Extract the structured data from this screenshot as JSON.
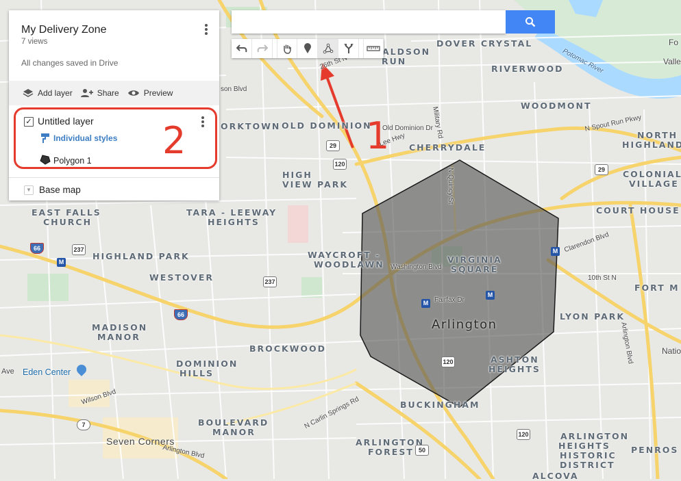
{
  "panel": {
    "title": "My Delivery Zone",
    "views": "7 views",
    "save_status": "All changes saved in Drive",
    "actions": {
      "add_layer": "Add layer",
      "share": "Share",
      "preview": "Preview"
    },
    "layer": {
      "title": "Untitled layer",
      "checked": true,
      "styles_link": "Individual styles",
      "feature": "Polygon 1"
    },
    "base_map": "Base map"
  },
  "search": {
    "placeholder": ""
  },
  "toolbar": {
    "tools": [
      "undo-icon",
      "redo-icon",
      "hand-icon",
      "marker-icon",
      "draw-line-icon",
      "route-icon",
      "ruler-icon"
    ],
    "active": "draw-line-icon"
  },
  "annotations": {
    "step1": "1",
    "step2": "2"
  },
  "map": {
    "place_labels": [
      {
        "text": "DOVER CRYSTAL"
      },
      {
        "text": "RIVERWOOD"
      },
      {
        "text": "WOODMONT"
      },
      {
        "text": "NORTH"
      },
      {
        "text": "HIGHLAND"
      },
      {
        "text": "COLONIAL"
      },
      {
        "text": "VILLAGE"
      },
      {
        "text": "COURT HOUSE"
      },
      {
        "text": "CHERRYDALE"
      },
      {
        "text": "ALDSON"
      },
      {
        "text": "RUN"
      },
      {
        "text": "ORKTOWN"
      },
      {
        "text": "OLD DOMINION"
      },
      {
        "text": "HIGH"
      },
      {
        "text": "VIEW PARK"
      },
      {
        "text": "EAST FALLS"
      },
      {
        "text": "CHURCH"
      },
      {
        "text": "TARA - LEEWAY"
      },
      {
        "text": "HEIGHTS"
      },
      {
        "text": "HIGHLAND PARK"
      },
      {
        "text": "WESTOVER"
      },
      {
        "text": "WAYCROFT -"
      },
      {
        "text": "WOODLAWN"
      },
      {
        "text": "VIRGINIA"
      },
      {
        "text": "SQUARE"
      },
      {
        "text": "LYON PARK"
      },
      {
        "text": "FORT M"
      },
      {
        "text": "MADISON"
      },
      {
        "text": "MANOR"
      },
      {
        "text": "BROCKWOOD"
      },
      {
        "text": "DOMINION"
      },
      {
        "text": "HILLS"
      },
      {
        "text": "ASHTON"
      },
      {
        "text": "HEIGHTS"
      },
      {
        "text": "BUCKINGHAM"
      },
      {
        "text": "BOULEVARD"
      },
      {
        "text": "MANOR"
      },
      {
        "text": "ARLINGTON"
      },
      {
        "text": "FOREST"
      },
      {
        "text": "ARLINGTON"
      },
      {
        "text": "HEIGHTS"
      },
      {
        "text": "HISTORIC"
      },
      {
        "text": "DISTRICT"
      },
      {
        "text": "PENROS"
      },
      {
        "text": "ALCOVA"
      }
    ],
    "city_label": "Arlington",
    "poi_labels": [
      "Eden Center",
      "Seven Corners",
      "Potomac River"
    ],
    "street_labels": [
      "Washington Blvd",
      "Fairfax Dr",
      "Clarendon Blvd",
      "10th St N",
      "Arlington Blvd",
      "Wilson Blvd",
      "N Carlin Springs Rd",
      "Old Dominion Dr",
      "Lee Hwy",
      "N Spout Run Pkwy",
      "Military Rd",
      "N Quincy St",
      "26th St N",
      "son Blvd",
      "N Carlin Springs Rd",
      "Arlington Blvd",
      "Ave",
      "Natio",
      "Fo",
      "Valle"
    ],
    "route_shields": [
      "29",
      "120",
      "66",
      "237",
      "237",
      "66",
      "29",
      "120",
      "50",
      "120",
      "7",
      "66"
    ],
    "metro_label": "M",
    "colors": {
      "polygon_fill": "#555555",
      "polygon_stroke": "#1a1a1a",
      "annotation": "#e53b2c",
      "water": "#aadaff",
      "highway": "#fcd86b",
      "park": "#cde8cf"
    }
  }
}
